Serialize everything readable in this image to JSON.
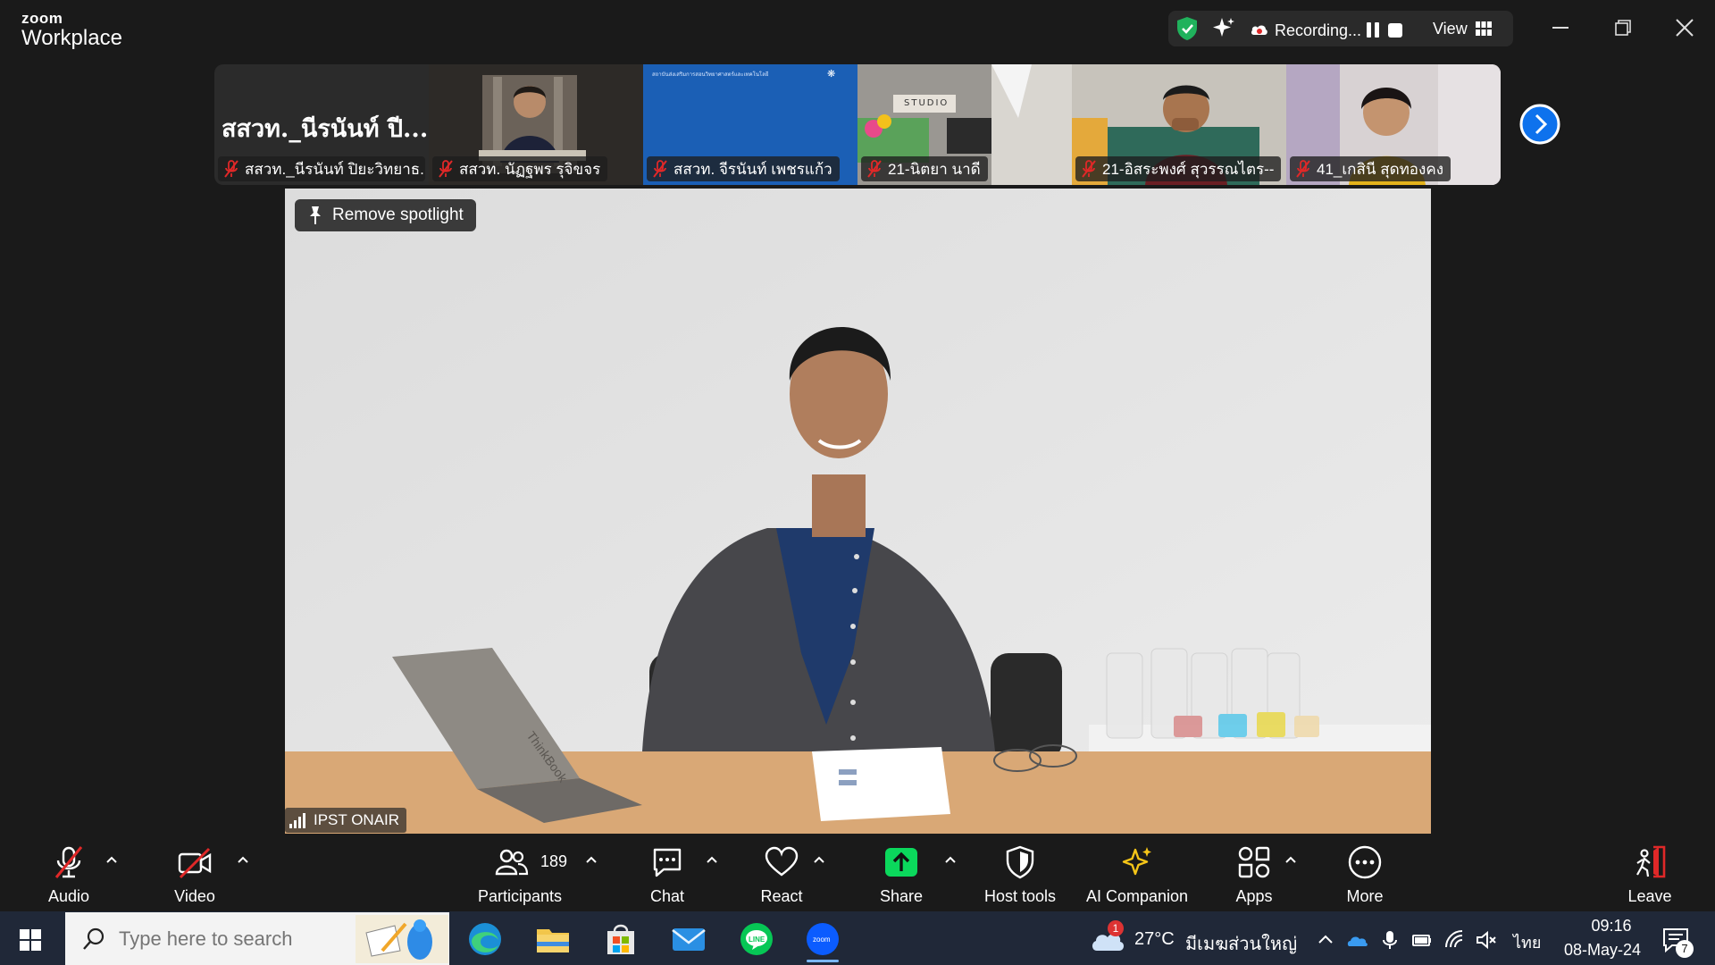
{
  "app": {
    "brand_top": "zoom",
    "brand_bottom": "Workplace"
  },
  "titlebar": {
    "recording_label": "Recording...",
    "view_label": "View"
  },
  "gallery": {
    "tiles": [
      {
        "big_name": "สสวท._นีรนันท์ ปี...",
        "name": "สสวท._นีรนันท์ ปิยะวิทยาธ...",
        "bg": "#2b2b2b"
      },
      {
        "name": "สสวท. นัฏฐพร รุจิขจร",
        "bg": "#3d3a36"
      },
      {
        "name": "สสวท. จีรนันท์ เพชรแก้ว",
        "bg": "#1b5fb5",
        "slide_text": "สถาบันส่งเสริมการสอนวิทยาศาสตร์และเทคโนโลยี"
      },
      {
        "name": "21-นิตยา  นาดี",
        "bg": "#8f8c86",
        "sign_text": "STUDIO"
      },
      {
        "name": "21-อิสระพงศ์ สุวรรณไตร--",
        "bg": "#b9b4aa"
      },
      {
        "name": "41_เกสินี สุดทองคง",
        "bg": "#c8c2bd"
      }
    ]
  },
  "stage": {
    "spotlight_label": "Remove spotlight",
    "participant_name": "IPST ONAIR",
    "laptop_brand": "ThinkBook"
  },
  "toolbar": {
    "audio": "Audio",
    "video": "Video",
    "participants": "Participants",
    "participants_count": "189",
    "chat": "Chat",
    "react": "React",
    "share": "Share",
    "host_tools": "Host tools",
    "ai_companion": "AI Companion",
    "apps": "Apps",
    "more": "More",
    "leave": "Leave"
  },
  "taskbar": {
    "search_placeholder": "Type here to search",
    "weather_temp": "27°C",
    "weather_desc": "มีเมฆส่วนใหญ่",
    "weather_badge": "1",
    "language": "ไทย",
    "time": "09:16",
    "date": "08-May-24",
    "notification_count": "7"
  },
  "colors": {
    "accent": "#0e72ed",
    "share": "#0bd85c",
    "mute_red": "#e02828",
    "recording_red": "#e02828",
    "shield_green": "#20b25c"
  },
  "icons": [
    "shield-icon",
    "sparkle-icon",
    "record-icon",
    "pause-icon",
    "stop-icon",
    "grid-icon",
    "minimize-icon",
    "maximize-icon",
    "close-icon",
    "mic-off-icon",
    "chevron-right-icon",
    "pin-icon",
    "signal-icon",
    "video-off-icon",
    "participants-icon",
    "chat-icon",
    "heart-icon",
    "share-arrow-icon",
    "host-shield-icon",
    "ai-sparkle-icon",
    "apps-icon",
    "ellipsis-icon",
    "leave-icon",
    "windows-start-icon",
    "search-icon",
    "edge-icon",
    "folder-icon",
    "store-icon",
    "mail-icon",
    "line-icon",
    "zoom-icon",
    "cloud-icon"
  ]
}
